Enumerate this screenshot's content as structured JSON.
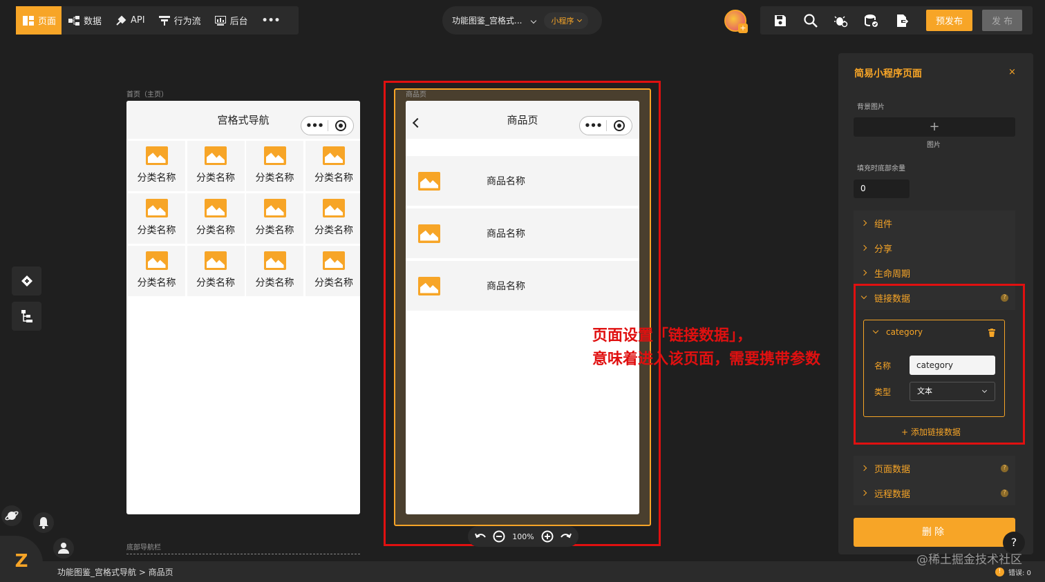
{
  "topbar": {
    "tabs": [
      {
        "label": "页面",
        "icon": "page-icon",
        "active": true
      },
      {
        "label": "数据",
        "icon": "data-icon"
      },
      {
        "label": "API",
        "icon": "api-icon"
      },
      {
        "label": "行为流",
        "icon": "flow-icon"
      },
      {
        "label": "后台",
        "icon": "backend-icon"
      }
    ],
    "more": "•••",
    "project_name": "功能图鉴_宫格式...",
    "platform": "小程序",
    "prepublish": "预发布",
    "publish": "发 布"
  },
  "canvas": {
    "home_label": "首页（主页）",
    "home_title": "宫格式导航",
    "category_label": "分类名称",
    "category_count": 12,
    "capsule_dots": "•••",
    "product_page_label": "商品页",
    "product_title": "商品页",
    "product_items": [
      "商品名称",
      "商品名称",
      "商品名称"
    ],
    "bottom_nav_label": "底部导航栏",
    "zoom": "100%"
  },
  "annotation": {
    "line1": "页面设置「链接数据」，",
    "line2": "意味着进入该页面，需要携带参数"
  },
  "panel": {
    "title": "简易小程序页面",
    "close": "×",
    "bg_image_label": "背景图片",
    "bg_image_add": "+",
    "bg_image_caption": "图片",
    "fill_label": "填充时底部余量",
    "fill_value": "0",
    "sections": {
      "components": "组件",
      "share": "分享",
      "lifecycle": "生命周期",
      "link_data": "链接数据",
      "page_data": "页面数据",
      "remote_data": "远程数据"
    },
    "qmark": "?",
    "link_item": {
      "name": "category",
      "name_label": "名称",
      "name_value": "category",
      "type_label": "类型",
      "type_value": "文本"
    },
    "add_link": "+ 添加链接数据",
    "delete": "删除"
  },
  "statusbar": {
    "breadcrumb": "功能图鉴_宫格式导航 > 商品页",
    "watermark": "@稀土掘金技术社区",
    "warn_icon": "!",
    "errors": "错误: 0",
    "help": "?",
    "logo": "Z"
  },
  "colors": {
    "accent": "#f7a527",
    "annotation": "#e01010",
    "background": "#1f1f1f",
    "panel": "#2b2b2b"
  }
}
